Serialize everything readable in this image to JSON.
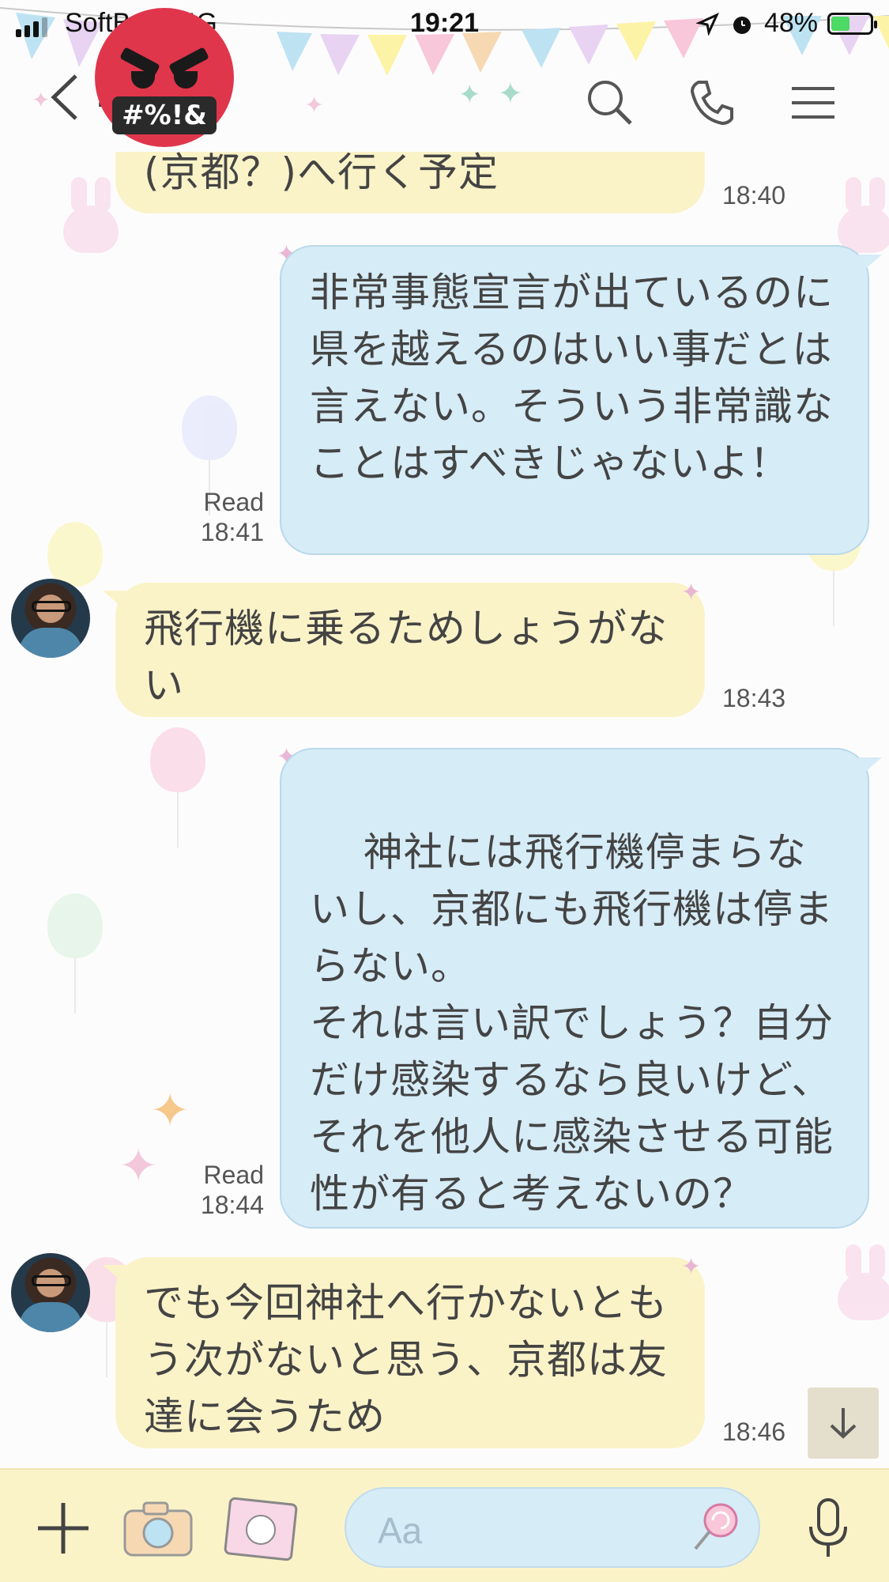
{
  "status_bar": {
    "carrier": "SoftBank",
    "network": "4G",
    "time": "19:21",
    "battery": "48%",
    "battery_level": 0.48
  },
  "header": {
    "chat_title": "…",
    "sticker_label": "#%!&"
  },
  "messages": [
    {
      "id": 1,
      "side": "in",
      "text": "(京都？)へ行く予定",
      "time": "18:40"
    },
    {
      "id": 2,
      "side": "out",
      "text": "非常事態宣言が出ているのに県を越えるのはいい事だとは言えない。そういう非常識なことはすべきじゃないよ！",
      "read": "Read",
      "time": "18:41"
    },
    {
      "id": 3,
      "side": "in",
      "text": "飛行機に乗るためしょうがない",
      "time": "18:43"
    },
    {
      "id": 4,
      "side": "out",
      "text": "神社には飛行機停まらないし、京都にも飛行機は停まらない。\nそれは言い訳でしょう？自分だけ感染するなら良いけど、それを他人に感染させる可能性が有ると考えないの？",
      "read": "Read",
      "time": "18:44"
    },
    {
      "id": 5,
      "side": "in",
      "text": "でも今回神社へ行かないともう次がないと思う、京都は友達に会うため",
      "time": "18:46"
    }
  ],
  "input": {
    "placeholder": "Aa"
  },
  "icons": {
    "back": "chevron-left-icon",
    "search": "search-icon",
    "call": "phone-icon",
    "menu": "menu-icon",
    "add": "plus-icon",
    "camera": "camera-icon",
    "photo": "image-icon",
    "sticker": "sticker-icon",
    "mic": "microphone-icon",
    "scroll": "arrow-down-icon"
  },
  "colors": {
    "incoming_bubble": "#fbf3c8",
    "outgoing_bubble": "#d6ecf7",
    "bottom_bar": "#fbf3c8",
    "battery_fill": "#4cd964"
  }
}
